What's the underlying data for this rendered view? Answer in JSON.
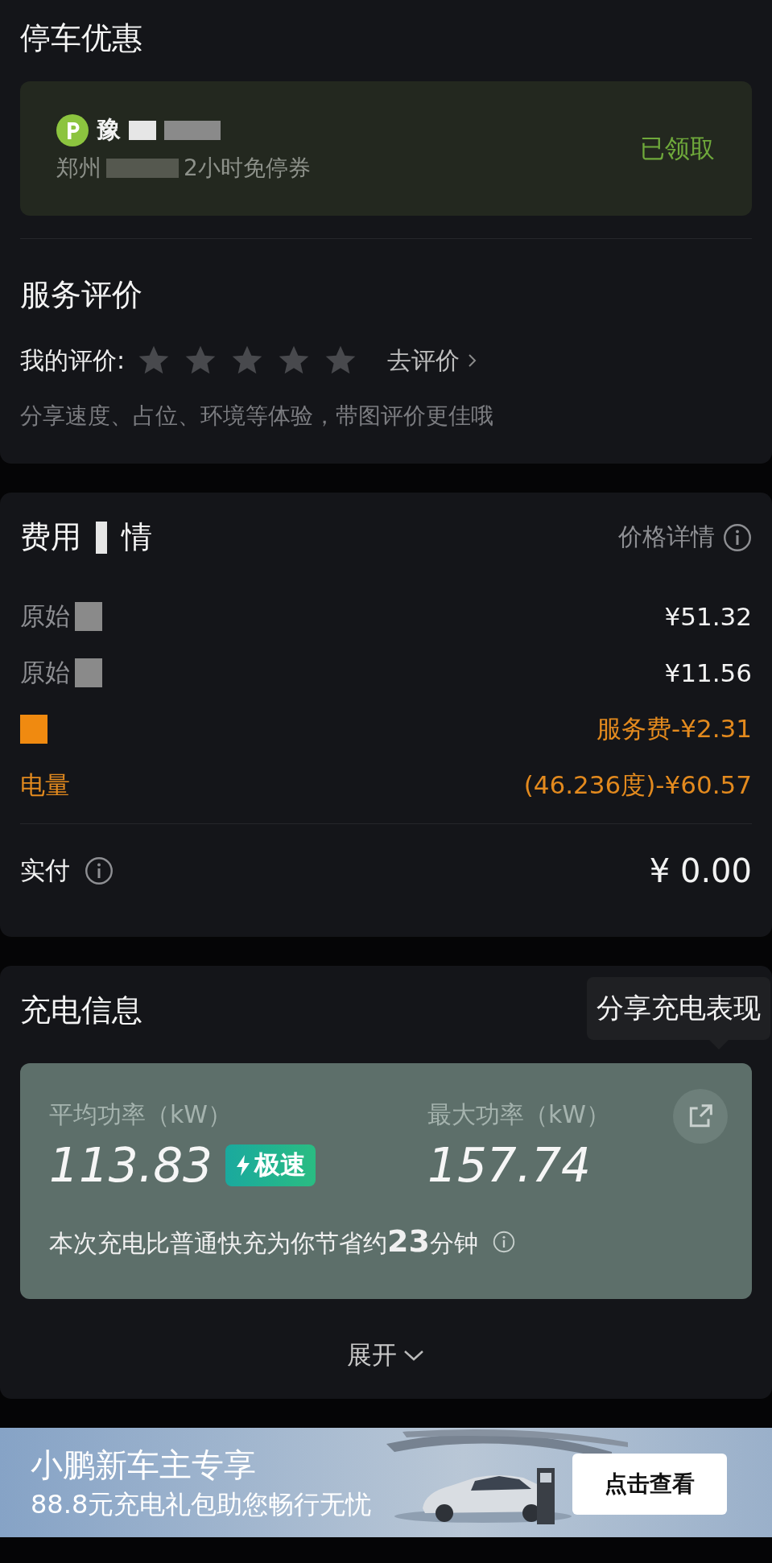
{
  "parking": {
    "title": "停车优惠",
    "plate": "豫",
    "coupon_parts": [
      "郑州",
      "2小时免停券"
    ],
    "status": "已领取"
  },
  "review": {
    "title": "服务评价",
    "label": "我的评价:",
    "stars": 0,
    "action": "去评价",
    "hint": "分享速度、占位、环境等体验，带图评价更佳哦"
  },
  "fees": {
    "title_parts": [
      "费用",
      "情"
    ],
    "detail_link": "价格详情",
    "rows": [
      {
        "label": "原始",
        "value": "¥51.32",
        "kind": "charge",
        "redacted": true
      },
      {
        "label": "原始",
        "value": "¥11.56",
        "kind": "charge",
        "redacted": true
      },
      {
        "value": "服务费-¥2.31",
        "kind": "discount",
        "redacted": true
      },
      {
        "label": "电量",
        "value": "(46.236度)-¥60.57",
        "kind": "discount",
        "redacted": false
      }
    ],
    "total": {
      "label": "实付",
      "value": "¥ 0.00"
    }
  },
  "charging": {
    "title": "充电信息",
    "tooltip": "分享充电表现",
    "avg_label": "平均功率（kW）",
    "avg_value": "113.83",
    "badge": "极速",
    "max_label": "最大功率（kW）",
    "max_value": "157.74",
    "saving": "本次充电比普通快充为你节省约**23**分钟",
    "expand": "展开"
  },
  "banner": {
    "title": "小鹏新车主专享",
    "subtitle": "88.8元充电礼包助您畅行无忧",
    "button": "点击查看"
  }
}
